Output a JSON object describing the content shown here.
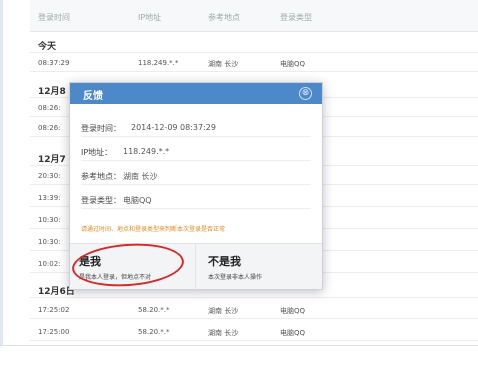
{
  "table": {
    "headers": [
      "登录时间",
      "IP地址",
      "参考地点",
      "登录类型"
    ],
    "groups": [
      {
        "label": "今天",
        "rows": [
          {
            "time": "08:37:29",
            "ip": "118.249.*.*",
            "loc": "湖南 长沙",
            "type": "电脑QQ"
          }
        ]
      },
      {
        "label": "12月8",
        "rows": [
          {
            "time": "08:26:",
            "ip": "",
            "loc": "",
            "type": ""
          },
          {
            "time": "08:26:",
            "ip": "",
            "loc": "",
            "type": ""
          }
        ]
      },
      {
        "label": "12月7",
        "rows": [
          {
            "time": "20:30:",
            "ip": "",
            "loc": "",
            "type": ""
          },
          {
            "time": "13:39:",
            "ip": "",
            "loc": "",
            "type": ""
          },
          {
            "time": "10:30:",
            "ip": "",
            "loc": "",
            "type": ""
          },
          {
            "time": "10:30:",
            "ip": "",
            "loc": "",
            "type": ""
          },
          {
            "time": "10:02:",
            "ip": "",
            "loc": "",
            "type": ""
          }
        ]
      },
      {
        "label": "12月6日",
        "rows": [
          {
            "time": "17:25:02",
            "ip": "58.20.*.*",
            "loc": "湖南 长沙",
            "type": "电脑QQ"
          },
          {
            "time": "17:25:00",
            "ip": "58.20.*.*",
            "loc": "湖南 长沙",
            "type": "电脑QQ"
          }
        ]
      }
    ]
  },
  "modal": {
    "title": "反馈",
    "close_glyph": "⊗",
    "fields": [
      {
        "label": "登录时间：",
        "value": "2014-12-09 08:37:29"
      },
      {
        "label": "IP地址：",
        "value": "118.249.*.*"
      },
      {
        "label": "参考地点：",
        "value": "湖南 长沙"
      },
      {
        "label": "登录类型：",
        "value": "电脑QQ"
      }
    ],
    "notice": "请通过时间、地点和登录类型来判断本次登录是否正常",
    "yes": {
      "title": "是我",
      "desc": "是我本人登录，但地点不对"
    },
    "no": {
      "title": "不是我",
      "desc": "本次登录非本人操作"
    }
  },
  "colors": {
    "modal_header": "#4c89c8",
    "notice": "#e08a1e",
    "highlight": "#d42a2a"
  }
}
